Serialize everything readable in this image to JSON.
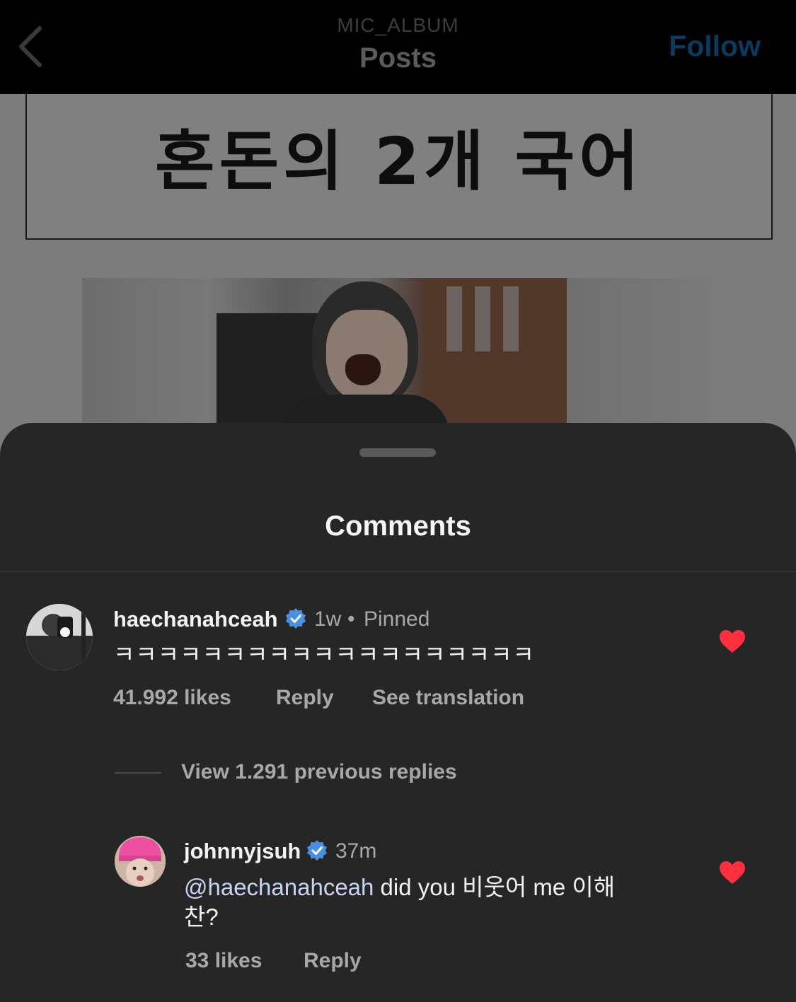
{
  "topbar": {
    "account_name": "MIC_ALBUM",
    "title": "Posts",
    "follow_label": "Follow",
    "back_icon": "chevron-left-icon"
  },
  "post": {
    "banner_text": "혼돈의 2개 국어"
  },
  "comments_sheet": {
    "title": "Comments",
    "comments": [
      {
        "username": "haechanahceah",
        "verified": true,
        "time": "1w",
        "separator": "•",
        "pinned_label": "Pinned",
        "text": "ㅋㅋㅋㅋㅋㅋㅋㅋㅋㅋㅋㅋㅋㅋㅋㅋㅋㅋㅋ",
        "likes": "41.992 likes",
        "reply_label": "Reply",
        "translate_label": "See translation",
        "liked": true
      }
    ],
    "view_replies_label": "View 1.291 previous replies",
    "replies": [
      {
        "username": "johnnyjsuh",
        "verified": true,
        "time": "37m",
        "mention": "@haechanahceah",
        "text_line1": " did you 비웃어 me 이해",
        "text_line2": "찬?",
        "likes": "33 likes",
        "reply_label": "Reply",
        "liked": true
      }
    ]
  },
  "colors": {
    "sheet_bg": "#262626",
    "heart": "#ff3040",
    "verified": "#4a90e2",
    "follow": "#0b3a5c"
  }
}
